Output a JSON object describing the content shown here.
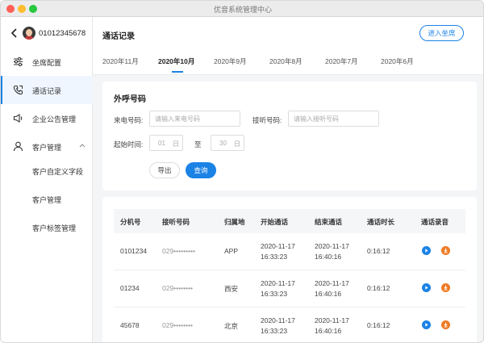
{
  "window": {
    "title": "优音系统管理中心"
  },
  "sidebar": {
    "phone": "01012345678",
    "items": [
      {
        "label": "坐席配置",
        "icon": "sliders-icon"
      },
      {
        "label": "通话记录",
        "icon": "phone-icon"
      },
      {
        "label": "企业公告管理",
        "icon": "speaker-icon"
      },
      {
        "label": "客户管理",
        "icon": "user-icon"
      }
    ],
    "sub_items": [
      {
        "label": "客户自定义字段"
      },
      {
        "label": "客户管理"
      },
      {
        "label": "客户标签管理"
      }
    ]
  },
  "header": {
    "title": "通话记录",
    "enter_label": "进入坐席",
    "tabs": [
      "2020年11月",
      "2020年10月",
      "2020年9月",
      "2020年8月",
      "2020年7月",
      "2020年6月"
    ],
    "active_tab": "2020年10月"
  },
  "filter": {
    "title": "外呼号码",
    "caller_label": "来电号码:",
    "caller_placeholder": "请输入来电号码",
    "callee_label": "接听号码:",
    "callee_placeholder": "请输入接听号码",
    "time_label": "起始时间:",
    "start_day": "01",
    "end_day": "30",
    "day_unit": "日",
    "to_label": "至",
    "export_label": "导出",
    "query_label": "查询"
  },
  "table": {
    "headers": [
      "分机号",
      "接听号码",
      "归属地",
      "开始通话",
      "结束通话",
      "通话时长",
      "通话录音"
    ],
    "rows": [
      {
        "ext": "0101234",
        "callee": "029•••••••••",
        "location": "APP",
        "start_date": "2020-11-17",
        "start_time": "16:33:23",
        "end_date": "2020-11-17",
        "end_time": "16:40:16",
        "duration": "0:16:12"
      },
      {
        "ext": "01234",
        "callee": "029••••••••",
        "location": "西安",
        "start_date": "2020-11-17",
        "start_time": "16:33:23",
        "end_date": "2020-11-17",
        "end_time": "16:40:16",
        "duration": "0:16:12"
      },
      {
        "ext": "45678",
        "callee": "029••••••••",
        "location": "北京",
        "start_date": "2020-11-17",
        "start_time": "16:33:23",
        "end_date": "2020-11-17",
        "end_time": "16:40:16",
        "duration": "0:16:12"
      }
    ]
  },
  "colors": {
    "accent": "#1b82e6",
    "download": "#f07a22"
  }
}
